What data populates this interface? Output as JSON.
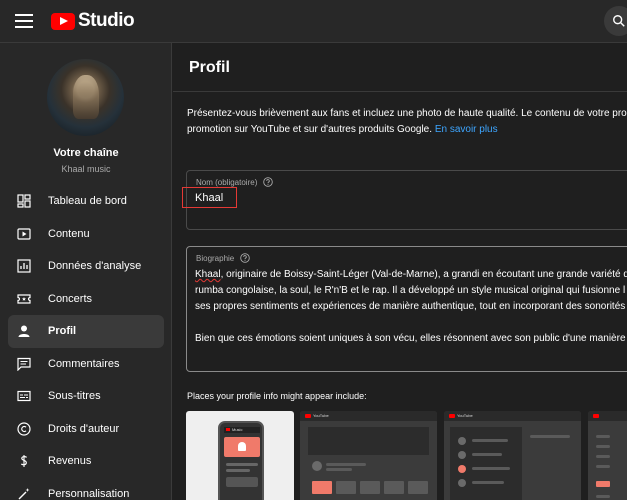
{
  "app": {
    "logo_text": "Studio"
  },
  "sidebar": {
    "channel_title": "Votre chaîne",
    "channel_name": "Khaal music",
    "items": [
      {
        "label": "Tableau de bord",
        "icon": "dashboard-icon"
      },
      {
        "label": "Contenu",
        "icon": "content-icon"
      },
      {
        "label": "Données d'analyse",
        "icon": "analytics-icon"
      },
      {
        "label": "Concerts",
        "icon": "ticket-icon"
      },
      {
        "label": "Profil",
        "icon": "person-icon",
        "active": true
      },
      {
        "label": "Commentaires",
        "icon": "comments-icon"
      },
      {
        "label": "Sous-titres",
        "icon": "subtitles-icon"
      },
      {
        "label": "Droits d'auteur",
        "icon": "copyright-icon"
      },
      {
        "label": "Revenus",
        "icon": "dollar-icon"
      },
      {
        "label": "Personnalisation",
        "icon": "magic-wand-icon"
      }
    ]
  },
  "main": {
    "title": "Profil",
    "intro_line1": "Présentez-vous brièvement aux fans et incluez une photo de haute qualité. Le contenu de votre pro",
    "intro_line2": "promotion sur YouTube et sur d'autres produits Google.",
    "learn_more": "En savoir plus",
    "name_field": {
      "label": "Nom (obligatoire)",
      "value": "Khaal"
    },
    "bio_field": {
      "label": "Biographie",
      "word1": "Khaal",
      "line1_rest": ", originaire de Boissy-Saint-Léger (Val-de-Marne), a grandi en écoutant une grande variété d",
      "line2": "rumba congolaise, la soul, le R'n'B et le rap. Il a développé un style musical original qui fusionne l",
      "line3": "ses propres sentiments et expériences de manière authentique, tout en incorporant des sonorités",
      "line4": "Bien que ces émotions soient uniques à son vécu, elles résonnent avec son public d'une manière"
    },
    "places_label": "Places your profile info might appear include:",
    "preview_logo_text": "Music",
    "preview_yt_text": "YouTube"
  },
  "colors": {
    "accent_link": "#3ea6ff",
    "youtube_red": "#ff0000",
    "highlight": "#e53935"
  }
}
